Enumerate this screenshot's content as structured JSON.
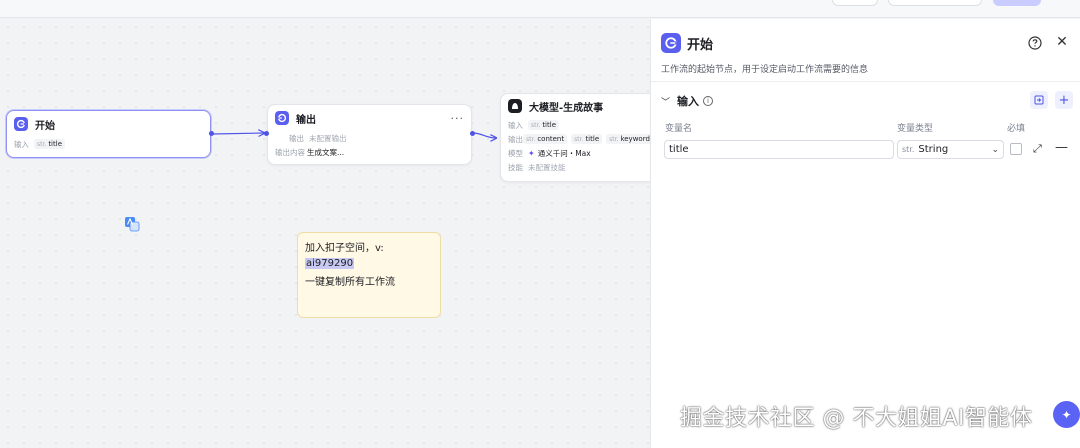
{
  "nodes": {
    "start": {
      "title": "开始",
      "input_key": "输入",
      "input_type": "str.",
      "input_name": "title"
    },
    "output": {
      "title": "输出",
      "output_key": "输出",
      "output_value": "未配置输出",
      "content_key": "输出内容",
      "content_value": "生成文案...",
      "more": "···"
    },
    "llm": {
      "title": "大模型-生成故事",
      "input_key": "输入",
      "input_type": "str.",
      "input_name": "title",
      "output_key": "输出",
      "outputs": [
        {
          "type": "str.",
          "name": "content"
        },
        {
          "type": "str.",
          "name": "title"
        },
        {
          "type": "str.",
          "name": "keyword"
        }
      ],
      "model_key": "模型",
      "model_value": "通义千问・Max",
      "skill_key": "技能",
      "skill_value": "未配置技能"
    }
  },
  "note": {
    "line1": "加入扣子空间，v:",
    "line2": "ai979290",
    "line3": "一键复制所有工作流"
  },
  "panel": {
    "title": "开始",
    "description": "工作流的起始节点，用于设定启动工作流需要的信息",
    "section_title": "输入",
    "col_name": "变量名",
    "col_type": "变量类型",
    "col_required": "必填",
    "var_name_value": "title",
    "var_type_prefix": "str.",
    "var_type_value": "String"
  },
  "watermark": "掘金技术社区 @ 不大姐姐AI智能体",
  "colors": {
    "accent": "#5b5ff0",
    "note_bg": "#fff9e5",
    "selection": "#8f92f5"
  }
}
